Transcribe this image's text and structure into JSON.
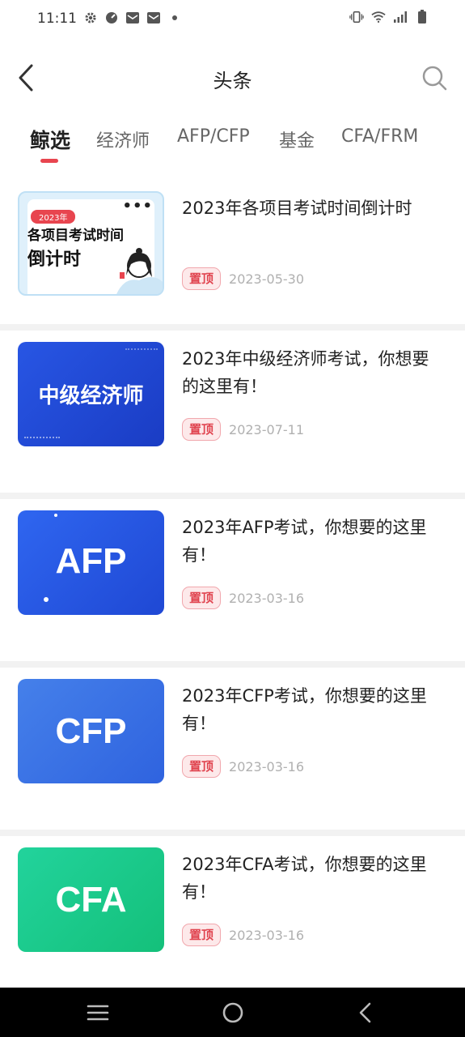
{
  "status_bar": {
    "time": "11:11",
    "left_icons": [
      "gear-icon",
      "speedometer-icon",
      "mail-icon",
      "mail-icon",
      "dot-icon"
    ],
    "right_icons": [
      "vibrate-icon",
      "wifi-icon",
      "signal-icon",
      "battery-icon"
    ]
  },
  "header": {
    "title": "头条",
    "back_icon": "chevron-left-icon",
    "search_icon": "search-icon"
  },
  "tabs": [
    {
      "label": "鲸选",
      "active": true
    },
    {
      "label": "经济师",
      "active": false
    },
    {
      "label": "AFP/CFP",
      "active": false
    },
    {
      "label": "基金",
      "active": false
    },
    {
      "label": "CFA/FRM",
      "active": false
    }
  ],
  "articles": [
    {
      "title": "2023年各项目考试时间倒计时",
      "badge": "置顶",
      "date": "2023-05-30",
      "thumb": {
        "year_tag": "2023年",
        "line1": "各项目考试时间",
        "line2": "倒计时",
        "bg": "#dff0fb"
      }
    },
    {
      "title": "2023年中级经济师考试，你想要的这里有！",
      "badge": "置顶",
      "date": "2023-07-11",
      "thumb": {
        "label": "中级经济师",
        "bg": "#1f49d6"
      }
    },
    {
      "title": "2023年AFP考试，你想要的这里有！",
      "badge": "置顶",
      "date": "2023-03-16",
      "thumb": {
        "label": "AFP",
        "bg": "#2a5ee8"
      }
    },
    {
      "title": "2023年CFP考试，你想要的这里有！",
      "badge": "置顶",
      "date": "2023-03-16",
      "thumb": {
        "label": "CFP",
        "bg": "#3a72e6"
      }
    },
    {
      "title": "2023年CFA考试，你想要的这里有！",
      "badge": "置顶",
      "date": "2023-03-16",
      "thumb": {
        "label": "CFA",
        "bg": "#1dc98a"
      }
    }
  ],
  "nav_bar": {
    "icons": [
      "menu-icon",
      "home-circle-icon",
      "back-triangle-icon"
    ]
  },
  "colors": {
    "accent": "#e8454f",
    "badge_bg": "#fde9ea",
    "date_gray": "#b0b0b0"
  }
}
